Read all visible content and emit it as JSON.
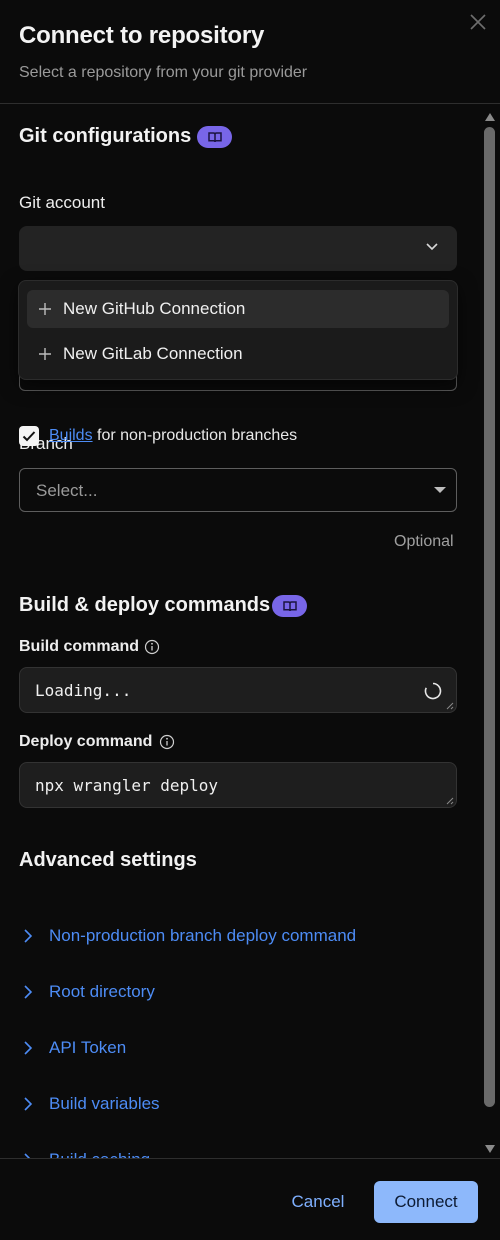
{
  "header": {
    "title": "Connect to repository",
    "subtitle": "Select a repository from your git provider"
  },
  "git_configurations": {
    "title": "Git configurations",
    "git_account_label": "Git account",
    "menu": {
      "items": [
        {
          "label": "New GitHub Connection"
        },
        {
          "label": "New GitLab Connection"
        }
      ]
    },
    "branch_label": "Branch",
    "branch_placeholder": "Select...",
    "builds_link": "Builds",
    "builds_text": " for non-production branches",
    "builds_checked": true
  },
  "build_deploy": {
    "title": "Build & deploy commands",
    "build_command_label": "Build command",
    "optional_label": "Optional",
    "build_command_value": "Loading...",
    "deploy_command_label": "Deploy command",
    "deploy_command_value": "npx wrangler deploy"
  },
  "advanced": {
    "title": "Advanced settings",
    "items": [
      {
        "label": "Non-production branch deploy command"
      },
      {
        "label": "Root directory"
      },
      {
        "label": "API Token"
      },
      {
        "label": "Build variables"
      },
      {
        "label": "Build caching"
      }
    ]
  },
  "footer": {
    "cancel_label": "Cancel",
    "connect_label": "Connect"
  },
  "colors": {
    "accent_badge": "#7866e8",
    "link": "#4d8cf5",
    "primary_button": "#8db8fb",
    "background": "#0b0b0b"
  },
  "icons": [
    "close-icon",
    "book-icon",
    "chevron-down-icon",
    "plus-icon",
    "caret-down-icon",
    "check-icon",
    "info-icon",
    "spinner-icon",
    "chevron-right-icon"
  ]
}
